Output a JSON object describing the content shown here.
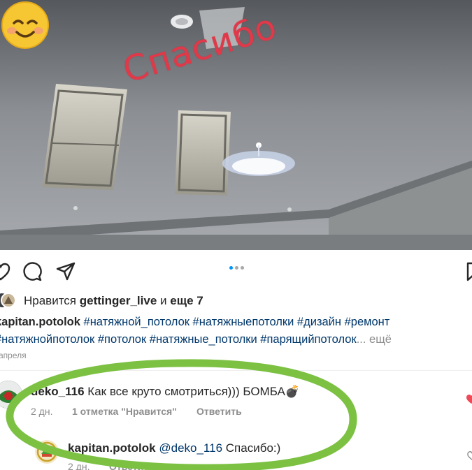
{
  "photo": {
    "sticker_text": "Спасибо",
    "emoji": "smiling-face-emoji"
  },
  "actions": {
    "icons": [
      "heart-icon",
      "comment-icon",
      "share-icon",
      "bookmark-icon"
    ]
  },
  "likes": {
    "prefix": "Нравится",
    "user": "gettinger_live",
    "and": "и",
    "others": "еще 7"
  },
  "caption": {
    "author": "kapitan.potolok",
    "line1_tags": "#натяжной_потолок #натяжныепотолки #дизайн #ремонт",
    "line2_tags": "#натяжнойпотолок #потолок #натяжные_потолки #парящийпотолок",
    "more": "... ещё"
  },
  "post_date": "апреля",
  "comments": [
    {
      "user": "deko_116",
      "text": "Как все круто смотриться))) БОМБА💣",
      "time": "2 дн.",
      "likes": "1 отметка \"Нравится\"",
      "reply": "Ответить"
    },
    {
      "user": "kapitan.potolok",
      "mention": "@deko_116",
      "text": "Спасибо:)",
      "time": "2 дн.",
      "reply": "Ответить"
    }
  ],
  "colors": {
    "hashtag": "#00376b",
    "meta": "#8e8e8e",
    "highlight_oval": "#7cc142",
    "sticker": "#e0394a",
    "carousel_dot_active": "#0095f6"
  }
}
